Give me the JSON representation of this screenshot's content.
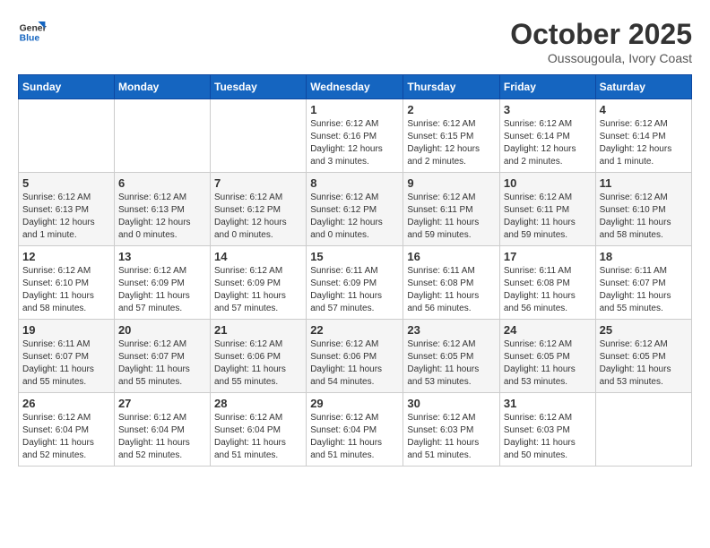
{
  "header": {
    "logo_text_general": "General",
    "logo_text_blue": "Blue",
    "month_year": "October 2025",
    "location": "Oussougoula, Ivory Coast"
  },
  "calendar": {
    "days_of_week": [
      "Sunday",
      "Monday",
      "Tuesday",
      "Wednesday",
      "Thursday",
      "Friday",
      "Saturday"
    ],
    "weeks": [
      [
        {
          "day": "",
          "info": ""
        },
        {
          "day": "",
          "info": ""
        },
        {
          "day": "",
          "info": ""
        },
        {
          "day": "1",
          "info": "Sunrise: 6:12 AM\nSunset: 6:16 PM\nDaylight: 12 hours and 3 minutes."
        },
        {
          "day": "2",
          "info": "Sunrise: 6:12 AM\nSunset: 6:15 PM\nDaylight: 12 hours and 2 minutes."
        },
        {
          "day": "3",
          "info": "Sunrise: 6:12 AM\nSunset: 6:14 PM\nDaylight: 12 hours and 2 minutes."
        },
        {
          "day": "4",
          "info": "Sunrise: 6:12 AM\nSunset: 6:14 PM\nDaylight: 12 hours and 1 minute."
        }
      ],
      [
        {
          "day": "5",
          "info": "Sunrise: 6:12 AM\nSunset: 6:13 PM\nDaylight: 12 hours and 1 minute."
        },
        {
          "day": "6",
          "info": "Sunrise: 6:12 AM\nSunset: 6:13 PM\nDaylight: 12 hours and 0 minutes."
        },
        {
          "day": "7",
          "info": "Sunrise: 6:12 AM\nSunset: 6:12 PM\nDaylight: 12 hours and 0 minutes."
        },
        {
          "day": "8",
          "info": "Sunrise: 6:12 AM\nSunset: 6:12 PM\nDaylight: 12 hours and 0 minutes."
        },
        {
          "day": "9",
          "info": "Sunrise: 6:12 AM\nSunset: 6:11 PM\nDaylight: 11 hours and 59 minutes."
        },
        {
          "day": "10",
          "info": "Sunrise: 6:12 AM\nSunset: 6:11 PM\nDaylight: 11 hours and 59 minutes."
        },
        {
          "day": "11",
          "info": "Sunrise: 6:12 AM\nSunset: 6:10 PM\nDaylight: 11 hours and 58 minutes."
        }
      ],
      [
        {
          "day": "12",
          "info": "Sunrise: 6:12 AM\nSunset: 6:10 PM\nDaylight: 11 hours and 58 minutes."
        },
        {
          "day": "13",
          "info": "Sunrise: 6:12 AM\nSunset: 6:09 PM\nDaylight: 11 hours and 57 minutes."
        },
        {
          "day": "14",
          "info": "Sunrise: 6:12 AM\nSunset: 6:09 PM\nDaylight: 11 hours and 57 minutes."
        },
        {
          "day": "15",
          "info": "Sunrise: 6:11 AM\nSunset: 6:09 PM\nDaylight: 11 hours and 57 minutes."
        },
        {
          "day": "16",
          "info": "Sunrise: 6:11 AM\nSunset: 6:08 PM\nDaylight: 11 hours and 56 minutes."
        },
        {
          "day": "17",
          "info": "Sunrise: 6:11 AM\nSunset: 6:08 PM\nDaylight: 11 hours and 56 minutes."
        },
        {
          "day": "18",
          "info": "Sunrise: 6:11 AM\nSunset: 6:07 PM\nDaylight: 11 hours and 55 minutes."
        }
      ],
      [
        {
          "day": "19",
          "info": "Sunrise: 6:11 AM\nSunset: 6:07 PM\nDaylight: 11 hours and 55 minutes."
        },
        {
          "day": "20",
          "info": "Sunrise: 6:12 AM\nSunset: 6:07 PM\nDaylight: 11 hours and 55 minutes."
        },
        {
          "day": "21",
          "info": "Sunrise: 6:12 AM\nSunset: 6:06 PM\nDaylight: 11 hours and 55 minutes."
        },
        {
          "day": "22",
          "info": "Sunrise: 6:12 AM\nSunset: 6:06 PM\nDaylight: 11 hours and 54 minutes."
        },
        {
          "day": "23",
          "info": "Sunrise: 6:12 AM\nSunset: 6:05 PM\nDaylight: 11 hours and 53 minutes."
        },
        {
          "day": "24",
          "info": "Sunrise: 6:12 AM\nSunset: 6:05 PM\nDaylight: 11 hours and 53 minutes."
        },
        {
          "day": "25",
          "info": "Sunrise: 6:12 AM\nSunset: 6:05 PM\nDaylight: 11 hours and 53 minutes."
        }
      ],
      [
        {
          "day": "26",
          "info": "Sunrise: 6:12 AM\nSunset: 6:04 PM\nDaylight: 11 hours and 52 minutes."
        },
        {
          "day": "27",
          "info": "Sunrise: 6:12 AM\nSunset: 6:04 PM\nDaylight: 11 hours and 52 minutes."
        },
        {
          "day": "28",
          "info": "Sunrise: 6:12 AM\nSunset: 6:04 PM\nDaylight: 11 hours and 51 minutes."
        },
        {
          "day": "29",
          "info": "Sunrise: 6:12 AM\nSunset: 6:04 PM\nDaylight: 11 hours and 51 minutes."
        },
        {
          "day": "30",
          "info": "Sunrise: 6:12 AM\nSunset: 6:03 PM\nDaylight: 11 hours and 51 minutes."
        },
        {
          "day": "31",
          "info": "Sunrise: 6:12 AM\nSunset: 6:03 PM\nDaylight: 11 hours and 50 minutes."
        },
        {
          "day": "",
          "info": ""
        }
      ]
    ]
  }
}
